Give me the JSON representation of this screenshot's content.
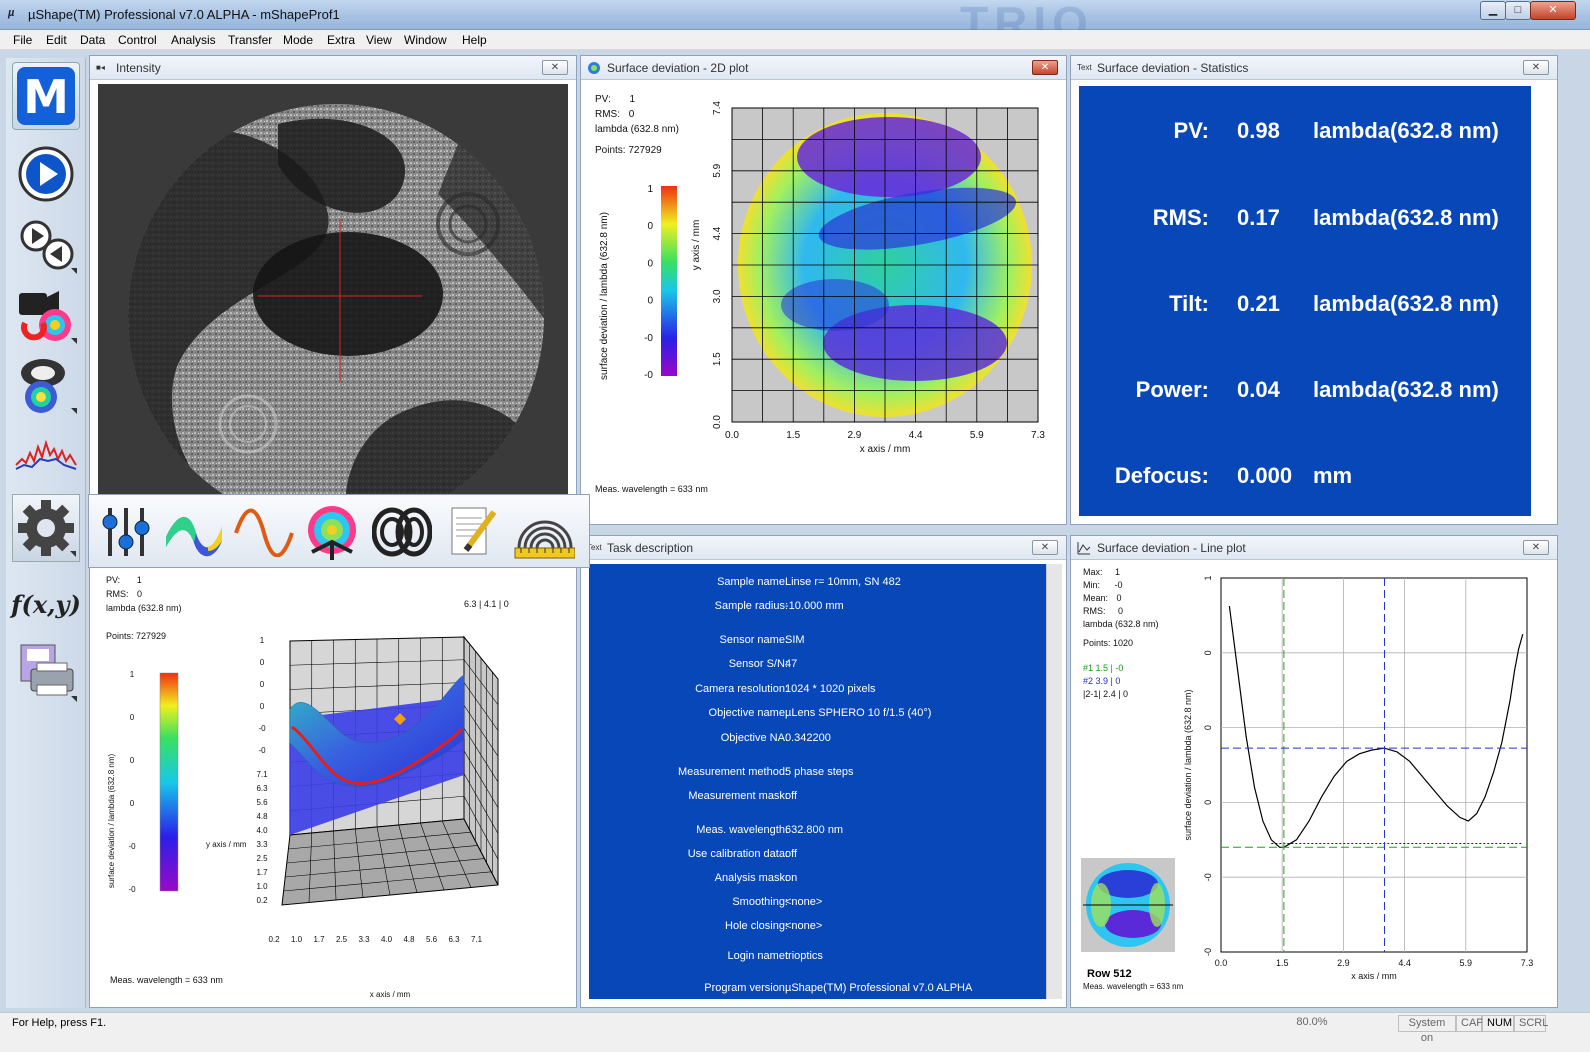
{
  "window": {
    "title": "µShape(TM) Professional v7.0 ALPHA - mShapeProf1",
    "watermark": "TRIO",
    "controls": {
      "minimize": "▁",
      "maximize": "□",
      "close": "✕"
    }
  },
  "menu": [
    "File",
    "Edit",
    "Data",
    "Control",
    "Analysis",
    "Transfer",
    "Mode",
    "Extra",
    "View",
    "Window",
    "Help"
  ],
  "toolbar_left": [
    "logo-m",
    "play",
    "play-sequence",
    "camera-phase",
    "surface-3d",
    "line-profile",
    "settings",
    "function-fxy",
    "print-save"
  ],
  "toolbar_left_label_fxy": "f(x,y)",
  "settings_toolbar": [
    "sliders",
    "zernike",
    "sine-wave",
    "phase-unwrap",
    "fringes",
    "notes",
    "ruler-fringes"
  ],
  "panels": {
    "intensity": {
      "title": "Intensity"
    },
    "plot2d": {
      "title": "Surface deviation - 2D plot",
      "pv_label": "PV:",
      "pv": "1",
      "rms_label": "RMS:",
      "rms": "0",
      "unit": "lambda (632.8 nm)",
      "points": "Points: 727929",
      "colorbar_ticks": [
        "1",
        "0",
        "0",
        "0",
        "-0",
        "-0"
      ],
      "colorbar_label": "surface deviation / lambda (632.8 nm)",
      "x_ticks": [
        "0.0",
        "1.5",
        "2.9",
        "4.4",
        "5.9",
        "7.3"
      ],
      "y_ticks": [
        "7.4",
        "5.9",
        "4.4",
        "3.0",
        "1.5",
        "0.0"
      ],
      "xlabel": "x axis / mm",
      "ylabel": "y axis / mm",
      "footer": "Meas. wavelength = 633 nm"
    },
    "stats": {
      "title": "Surface deviation - Statistics",
      "rows": [
        {
          "label": "PV:",
          "value": "0.98",
          "unit": "lambda(632.8 nm)"
        },
        {
          "label": "RMS:",
          "value": "0.17",
          "unit": "lambda(632.8 nm)"
        },
        {
          "label": "Tilt:",
          "value": "0.21",
          "unit": "lambda(632.8 nm)"
        },
        {
          "label": "Power:",
          "value": "0.04",
          "unit": "lambda(632.8 nm)"
        },
        {
          "label": "Defocus:",
          "value": "0.000",
          "unit": "mm"
        }
      ]
    },
    "plot3d": {
      "pv_label": "PV:",
      "pv": "1",
      "rms_label": "RMS:",
      "rms": "0",
      "unit": "lambda (632.8 nm)",
      "points": "Points: 727929",
      "cursor": "6.3 | 4.1 | 0",
      "colorbar_ticks": [
        "1",
        "0",
        "0",
        "0",
        "-0",
        "-0"
      ],
      "colorbar_label": "surface deviation / lambda (632.8 nm)",
      "z_ticks": [
        "1",
        "0",
        "0",
        "0",
        "-0",
        "-0"
      ],
      "y_ticks": [
        "7.1",
        "6.3",
        "5.6",
        "4.8",
        "4.0",
        "3.3",
        "2.5",
        "1.7",
        "1.0",
        "0.2"
      ],
      "x_ticks": [
        "0.2",
        "1.0",
        "1.7",
        "2.5",
        "3.3",
        "4.0",
        "4.8",
        "5.6",
        "6.3",
        "7.1"
      ],
      "ylabel": "y axis / mm",
      "xlabel": "x axis / mm",
      "footer": "Meas. wavelength = 633 nm"
    },
    "task": {
      "title": "Task description",
      "rows": [
        {
          "label": "Sample name:",
          "value": "Linse r= 10mm, SN 482"
        },
        {
          "label": "Sample radius:",
          "value": "-10.000 mm"
        },
        {
          "label": "Sensor name:",
          "value": "SIM"
        },
        {
          "label": "Sensor S/N:",
          "value": "47"
        },
        {
          "label": "Camera resolution:",
          "value": "1024 * 1020 pixels"
        },
        {
          "label": "Objective name:",
          "value": "µLens SPHERO 10 f/1.5 (40°)"
        },
        {
          "label": "Objective NA:",
          "value": "0.342200"
        },
        {
          "label": "Measurement method:",
          "value": "5 phase steps"
        },
        {
          "label": "Measurement mask:",
          "value": "off"
        },
        {
          "label": "Meas. wavelength:",
          "value": "632.800 nm"
        },
        {
          "label": "Use calibration data:",
          "value": "off"
        },
        {
          "label": "Analysis mask:",
          "value": "on"
        },
        {
          "label": "Smoothing:",
          "value": "<none>"
        },
        {
          "label": "Hole closing:",
          "value": "<none>"
        },
        {
          "label": "Login name:",
          "value": "trioptics"
        },
        {
          "label": "Program version:",
          "value": "µShape(TM) Professional v7.0 ALPHA"
        }
      ]
    },
    "lineplot": {
      "title": "Surface deviation - Line plot",
      "max_label": "Max:",
      "max": "1",
      "min_label": "Min:",
      "min": "-0",
      "mean_label": "Mean:",
      "mean": "0",
      "rms_label": "RMS:",
      "rms": "0",
      "unit": "lambda (632.8 nm)",
      "points": "Points: 1020",
      "cursor1": "#1   1.5 | -0",
      "cursor2": "#2   3.9 | 0",
      "cursor_diff": "|2-1| 2.4 | 0",
      "row_label": "Row  512",
      "footer": "Meas. wavelength = 633 nm",
      "ylabel": "surface deviation / lambda (632.8 nm)",
      "xlabel": "x axis / mm",
      "x_ticks": [
        "0.0",
        "1.5",
        "2.9",
        "4.4",
        "5.9",
        "7.3"
      ],
      "y_ticks": [
        "1",
        "0",
        "0",
        "0",
        "-0",
        "-0"
      ]
    }
  },
  "chart_data": {
    "type": "line",
    "xlabel": "x axis / mm",
    "ylabel": "surface deviation / lambda (632.8 nm)",
    "xlim": [
      0,
      7.3
    ],
    "ylim": [
      -1,
      1
    ],
    "x": [
      0.2,
      0.4,
      0.6,
      0.8,
      1.0,
      1.2,
      1.4,
      1.5,
      1.8,
      2.1,
      2.4,
      2.7,
      3.0,
      3.3,
      3.6,
      3.9,
      4.2,
      4.5,
      4.8,
      5.1,
      5.4,
      5.7,
      5.9,
      6.1,
      6.3,
      6.5,
      6.7,
      6.9,
      7.0,
      7.1,
      7.2
    ],
    "values": [
      0.85,
      0.5,
      0.15,
      -0.12,
      -0.3,
      -0.4,
      -0.44,
      -0.44,
      -0.4,
      -0.3,
      -0.17,
      -0.06,
      0.02,
      0.06,
      0.08,
      0.09,
      0.07,
      0.02,
      -0.06,
      -0.14,
      -0.22,
      -0.28,
      -0.3,
      -0.26,
      -0.17,
      -0.04,
      0.12,
      0.35,
      0.5,
      0.62,
      0.7
    ],
    "cursors": [
      {
        "name": "#1",
        "x": 1.5,
        "y": -0.44
      },
      {
        "name": "#2",
        "x": 3.9,
        "y": 0.09
      }
    ]
  },
  "status": {
    "help": "For Help, press F1.",
    "zoom": "80.0%",
    "system": "System on",
    "cap": "CAP",
    "num": "NUM",
    "scrl": "SCRL"
  }
}
